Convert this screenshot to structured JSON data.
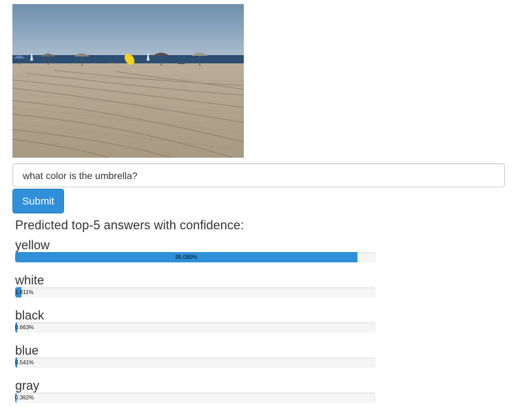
{
  "question": {
    "value": "what color is the umbrella?",
    "submit_label": "Submit"
  },
  "results": {
    "heading": "Predicted top-5 answers with confidence:",
    "answers": [
      {
        "label": "yellow",
        "percent_text": "95.090%",
        "confidence": 95.09
      },
      {
        "label": "white",
        "percent_text": "1.811%",
        "confidence": 1.811
      },
      {
        "label": "black",
        "percent_text": "0.663%",
        "confidence": 0.663
      },
      {
        "label": "blue",
        "percent_text": "0.541%",
        "confidence": 0.541
      },
      {
        "label": "gray",
        "percent_text": "0.362%",
        "confidence": 0.362
      }
    ]
  },
  "colors": {
    "accent": "#2f8fd8",
    "track": "#f5f5f5"
  }
}
